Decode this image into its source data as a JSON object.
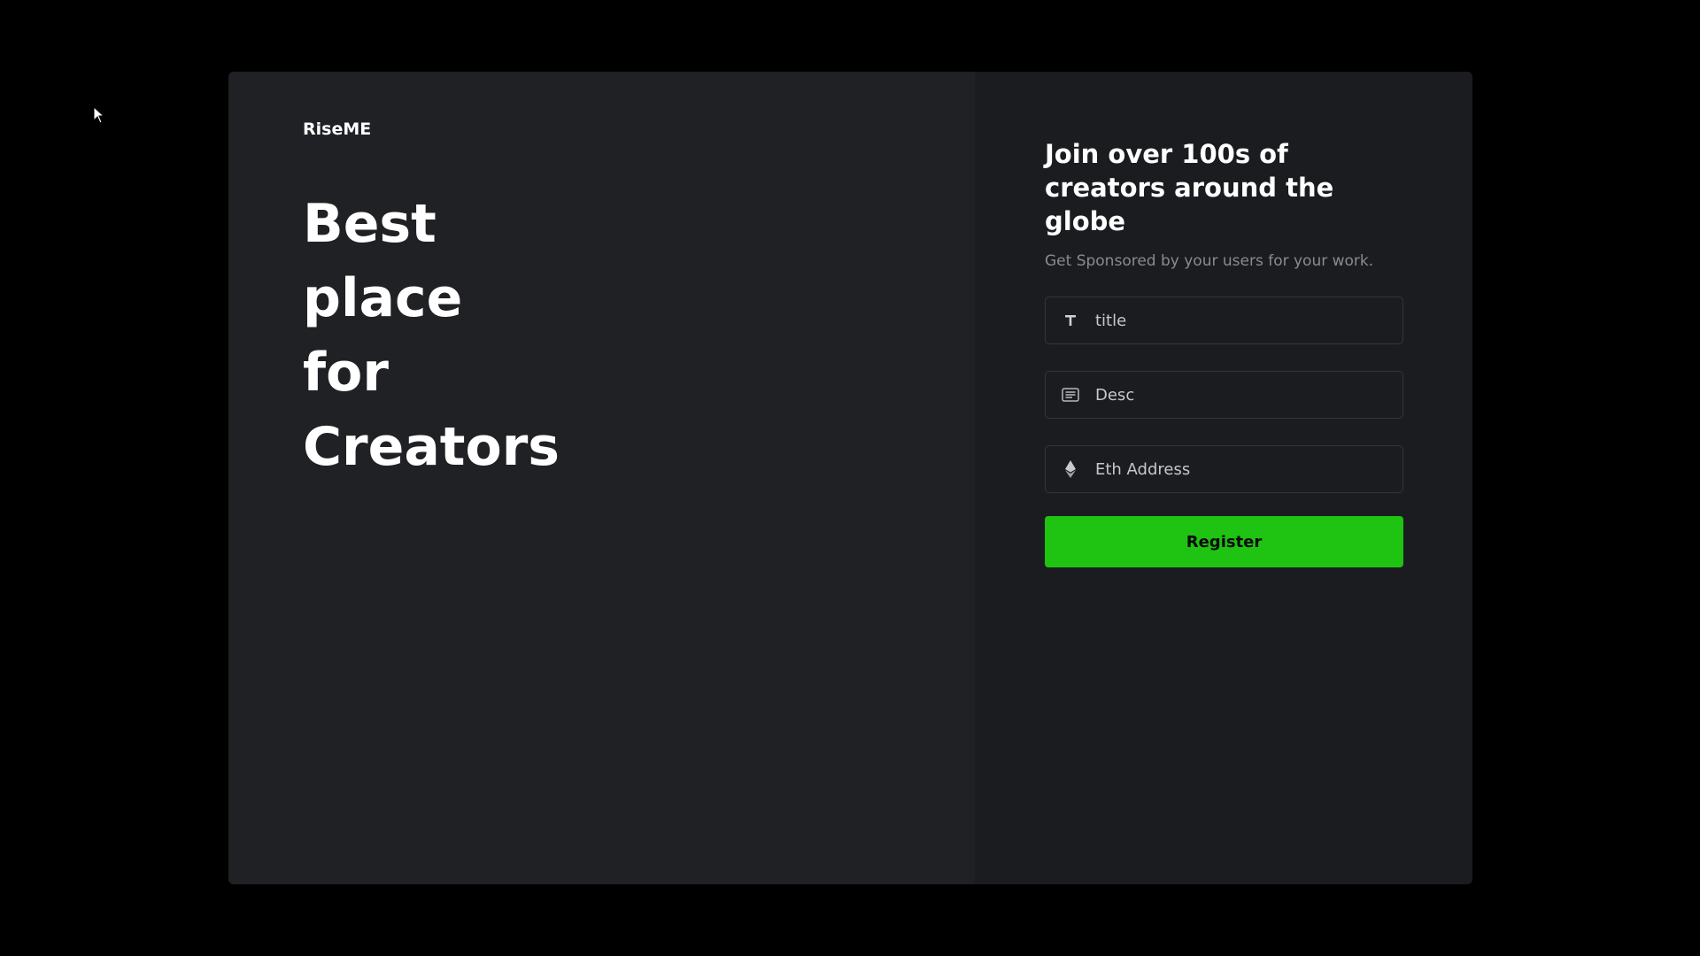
{
  "brand": {
    "name": "RiseME"
  },
  "hero": {
    "lines": [
      "Best",
      "place",
      "for",
      "Creators"
    ]
  },
  "form": {
    "title": "Join over 100s of creators around the globe",
    "subtitle": "Get Sponsored by your users for your work.",
    "fields": [
      {
        "icon": "text-icon",
        "placeholder": "title",
        "value": ""
      },
      {
        "icon": "description-icon",
        "placeholder": "Desc",
        "value": ""
      },
      {
        "icon": "ethereum-icon",
        "placeholder": "Eth Address",
        "value": ""
      }
    ],
    "submit_label": "Register"
  },
  "colors": {
    "page_background": "#000000",
    "card_left": "#202125",
    "card_right": "#1b1c20",
    "accent": "#1fc311",
    "text": "#ffffff",
    "muted_text": "#8a8b90"
  }
}
